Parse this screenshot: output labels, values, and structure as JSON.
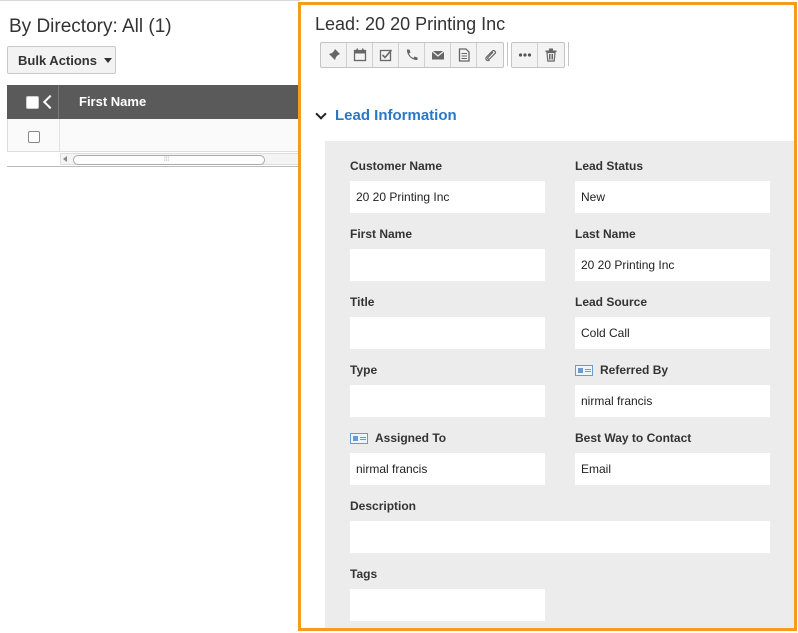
{
  "list": {
    "title": "By Directory: All (1)",
    "bulk_actions_label": "Bulk Actions",
    "columns": [
      "First Name"
    ]
  },
  "lead": {
    "title": "Lead: 20 20 Printing Inc",
    "toolbar_icons": [
      "pin-icon",
      "calendar-icon",
      "task-check-icon",
      "phone-icon",
      "email-icon",
      "note-icon",
      "attachment-icon",
      "more-icon",
      "trash-icon"
    ],
    "section_title": "Lead Information",
    "fields": {
      "customer_name": {
        "label": "Customer Name",
        "value": "20 20 Printing Inc"
      },
      "lead_status": {
        "label": "Lead Status",
        "value": "New"
      },
      "first_name": {
        "label": "First Name",
        "value": ""
      },
      "last_name": {
        "label": "Last Name",
        "value": "20 20 Printing Inc"
      },
      "title": {
        "label": "Title",
        "value": ""
      },
      "lead_source": {
        "label": "Lead Source",
        "value": "Cold Call"
      },
      "type": {
        "label": "Type",
        "value": ""
      },
      "referred_by": {
        "label": "Referred By",
        "value": "nirmal francis"
      },
      "assigned_to": {
        "label": "Assigned To",
        "value": "nirmal francis"
      },
      "best_way": {
        "label": "Best Way to Contact",
        "value": "Email"
      },
      "description": {
        "label": "Description",
        "value": ""
      },
      "tags": {
        "label": "Tags",
        "value": ""
      }
    }
  },
  "colors": {
    "accent_border": "#f29d1c",
    "section_title": "#2a77c8",
    "grid_header": "#5a5a5a"
  }
}
